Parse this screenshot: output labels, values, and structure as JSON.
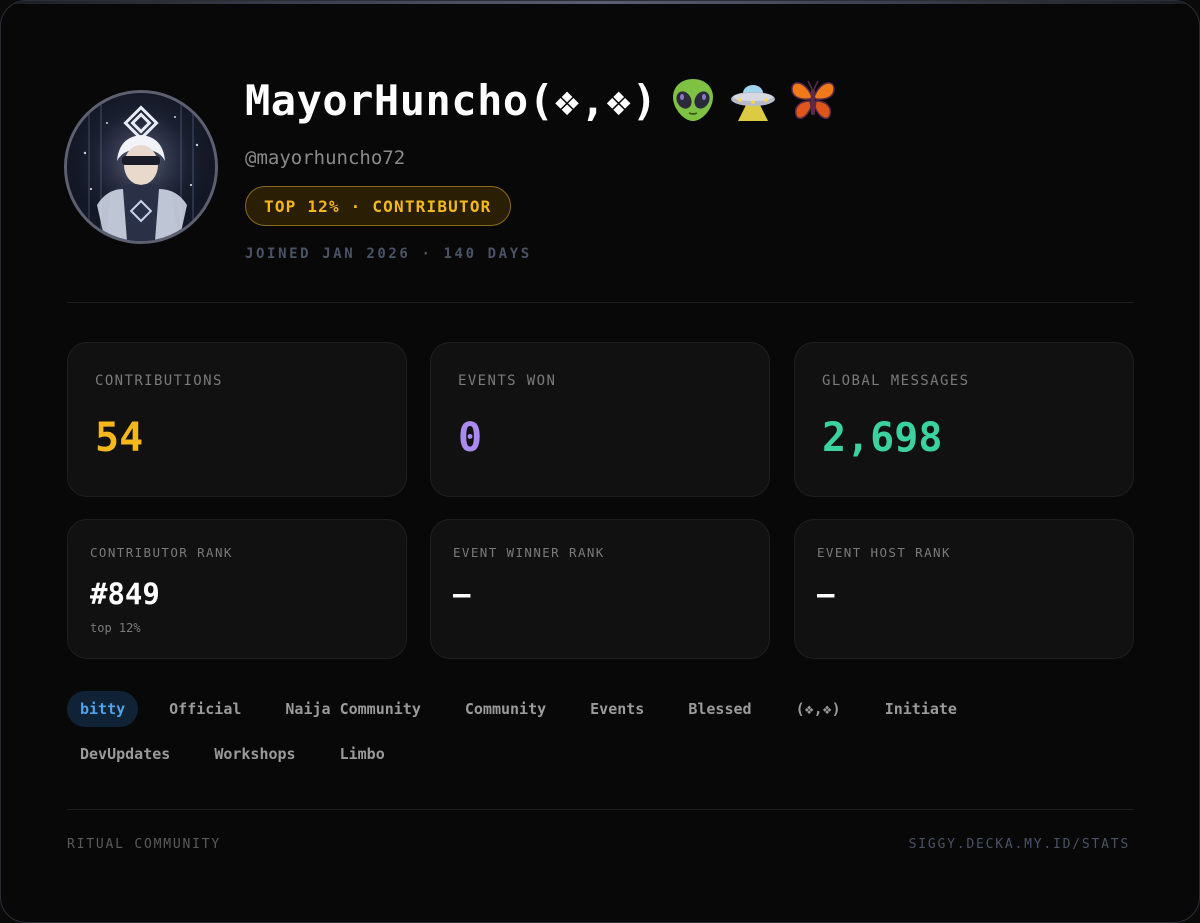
{
  "profile": {
    "display_name": "MayorHuncho(❖,❖)",
    "handle": "@mayorhuncho72",
    "badge": "TOP 12% · CONTRIBUTOR",
    "joined": "JOINED JAN 2026 · 140 DAYS",
    "emojis": [
      "alien-icon",
      "ufo-icon",
      "butterfly-icon"
    ]
  },
  "stats": [
    {
      "label": "CONTRIBUTIONS",
      "value": "54",
      "color": "#f5b81c"
    },
    {
      "label": "EVENTS WON",
      "value": "0",
      "color": "#a98bf0"
    },
    {
      "label": "GLOBAL MESSAGES",
      "value": "2,698",
      "color": "#3ad3a0"
    }
  ],
  "ranks": [
    {
      "label": "CONTRIBUTOR RANK",
      "value": "#849",
      "sub": "top 12%"
    },
    {
      "label": "EVENT WINNER RANK",
      "value": "—"
    },
    {
      "label": "EVENT HOST RANK",
      "value": "—"
    }
  ],
  "tags": [
    {
      "label": "bitty",
      "active": true
    },
    {
      "label": "Official"
    },
    {
      "label": "Naija Community"
    },
    {
      "label": "Community"
    },
    {
      "label": "Events"
    },
    {
      "label": "Blessed"
    },
    {
      "label": "(❖,❖)"
    },
    {
      "label": "Initiate"
    },
    {
      "label": "DevUpdates"
    },
    {
      "label": "Workshops"
    },
    {
      "label": "Limbo"
    }
  ],
  "footer": {
    "left": "RITUAL COMMUNITY",
    "right": "SIGGY.DECKA.MY.ID/STATS"
  },
  "colors": {
    "badge_gold": "#f5b81c",
    "tag_active": "#4fa3e8"
  }
}
